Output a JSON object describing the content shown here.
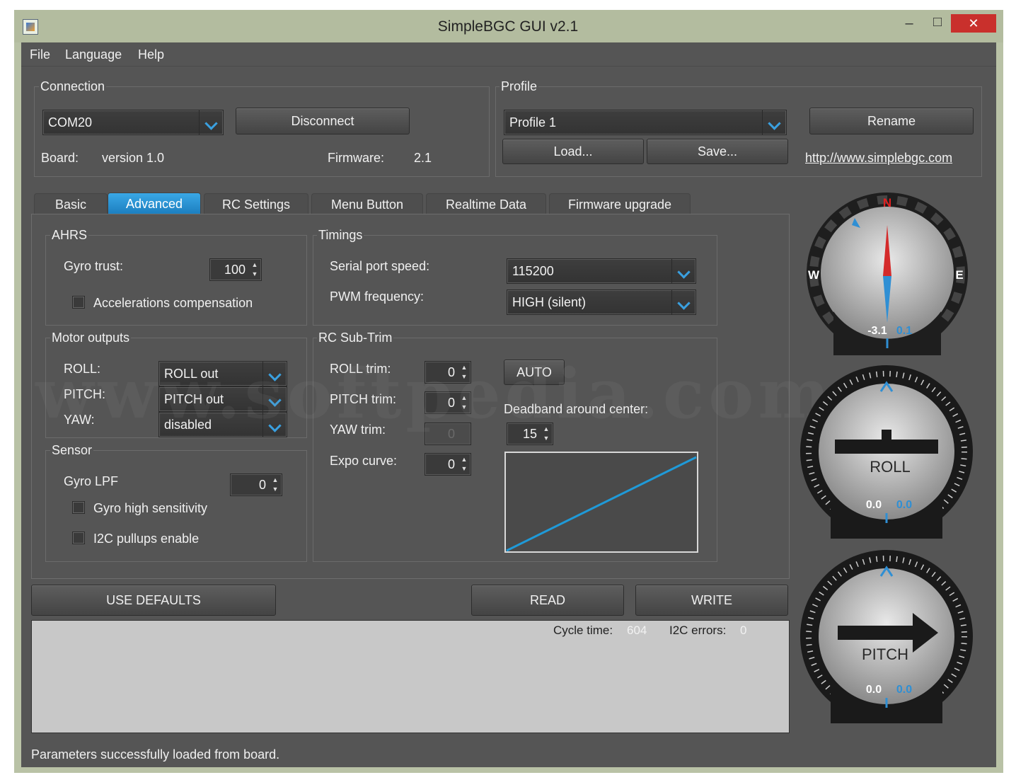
{
  "window": {
    "title": "SimpleBGC GUI v2.1",
    "minimize": "–",
    "maximize": "□",
    "close": "✕"
  },
  "menu": {
    "items": [
      "File",
      "Language",
      "Help"
    ]
  },
  "connection": {
    "legend": "Connection",
    "port": "COM20",
    "disconnect": "Disconnect",
    "board_label": "Board:",
    "board_value": "version 1.0",
    "firmware_label": "Firmware:",
    "firmware_value": "2.1"
  },
  "profile": {
    "legend": "Profile",
    "selected": "Profile 1",
    "rename": "Rename",
    "load": "Load...",
    "save": "Save...",
    "link": "http://www.simplebgc.com"
  },
  "tabs": [
    "Basic",
    "Advanced",
    "RC Settings",
    "Menu Button",
    "Realtime Data",
    "Firmware upgrade"
  ],
  "ahrs": {
    "legend": "AHRS",
    "gyro_trust_label": "Gyro trust:",
    "gyro_trust_value": "100",
    "acc_comp_label": "Accelerations compensation"
  },
  "timings": {
    "legend": "Timings",
    "serial_label": "Serial port speed:",
    "serial_value": "115200",
    "pwm_label": "PWM frequency:",
    "pwm_value": "HIGH (silent)"
  },
  "motor_outputs": {
    "legend": "Motor outputs",
    "roll_label": "ROLL:",
    "roll_value": "ROLL out",
    "pitch_label": "PITCH:",
    "pitch_value": "PITCH out",
    "yaw_label": "YAW:",
    "yaw_value": "disabled"
  },
  "rc_subtrim": {
    "legend": "RC Sub-Trim",
    "roll_label": "ROLL trim:",
    "roll_value": "0",
    "pitch_label": "PITCH trim:",
    "pitch_value": "0",
    "yaw_label": "YAW trim:",
    "yaw_value": "0",
    "expo_label": "Expo curve:",
    "expo_value": "0",
    "auto": "AUTO",
    "deadband_label": "Deadband around center:",
    "deadband_value": "15"
  },
  "sensor": {
    "legend": "Sensor",
    "gyro_lpf_label": "Gyro LPF",
    "gyro_lpf_value": "0",
    "gyro_high_label": "Gyro high sensitivity",
    "i2c_label": "I2C pullups enable"
  },
  "actions": {
    "defaults": "USE DEFAULTS",
    "read": "READ",
    "write": "WRITE"
  },
  "status": {
    "cycle_label": "Cycle time:",
    "cycle_value": "604",
    "i2c_label": "I2C errors:",
    "i2c_value": "0",
    "message": "Parameters successfully loaded from board."
  },
  "gauges": {
    "compass": {
      "n": "N",
      "e": "E",
      "w": "W",
      "value": "-3.1",
      "value2": "0.1"
    },
    "roll": {
      "label": "ROLL",
      "value": "0.0",
      "value2": "0.0"
    },
    "pitch": {
      "label": "PITCH",
      "value": "0.0",
      "value2": "0.0"
    }
  },
  "colors": {
    "accent": "#3aa0e0",
    "panel": "#555555",
    "compass_needle_north": "#d42a2a"
  },
  "watermark": "www.softpedia.com"
}
